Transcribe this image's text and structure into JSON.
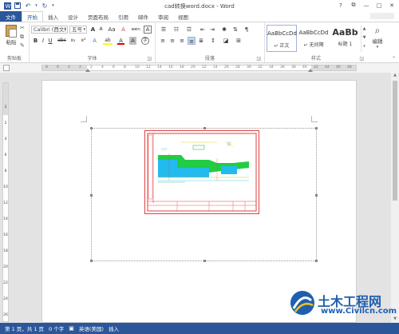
{
  "window": {
    "title": "cad转换word.docx - Word",
    "controls": {
      "help": "?",
      "restore": "⧉",
      "minimize": "—",
      "maximize": "□",
      "close": "✕"
    }
  },
  "quick_access": {
    "save": "save-icon",
    "undo": "undo-icon",
    "redo": "redo-icon"
  },
  "tabs": [
    {
      "label": "文件"
    },
    {
      "label": "开始"
    },
    {
      "label": "插入"
    },
    {
      "label": "设计"
    },
    {
      "label": "页面布局"
    },
    {
      "label": "引用"
    },
    {
      "label": "邮件"
    },
    {
      "label": "审阅"
    },
    {
      "label": "视图"
    }
  ],
  "ribbon": {
    "clipboard": {
      "paste_label": "粘贴",
      "group_label": "剪贴板"
    },
    "font": {
      "font_name": "Calibri (西文)",
      "font_size": "五号",
      "grow": "A",
      "shrink": "A",
      "case": "Aa",
      "clear": "A",
      "wen": "wén",
      "char_border": "A",
      "bold": "B",
      "italic": "I",
      "underline": "U",
      "strike": "abc",
      "subscript": "x₂",
      "superscript": "x²",
      "text_effects": "A",
      "highlight": "ab",
      "font_color": "A",
      "char_shading": "A",
      "enclose": "字",
      "group_label": "字体"
    },
    "paragraph": {
      "group_label": "段落"
    },
    "styles": {
      "items": [
        {
          "sample": "AaBbCcDd",
          "name": "↵ 正文"
        },
        {
          "sample": "AaBbCcDd",
          "name": "↵ 无间隔"
        },
        {
          "sample": "AaBb",
          "name": "标题 1"
        }
      ],
      "group_label": "样式"
    },
    "editing": {
      "label": "编辑"
    }
  },
  "ruler": {
    "h_ticks": [
      "8",
      "6",
      "4",
      "2",
      "2",
      "4",
      "6",
      "8",
      "10",
      "12",
      "14",
      "16",
      "18",
      "20",
      "22",
      "24",
      "26",
      "28",
      "30",
      "32",
      "34",
      "36",
      "38",
      "40",
      "42",
      "44",
      "46",
      "48"
    ],
    "v_ticks": [
      "2",
      "2",
      "4",
      "6",
      "8",
      "10",
      "12",
      "14",
      "16",
      "18",
      "20",
      "22",
      "24",
      "26"
    ]
  },
  "statusbar": {
    "page": "第 1 页，共 1 页",
    "words": "0 个字",
    "language": "英语(美国)",
    "mode": "插入"
  },
  "watermark": {
    "text": "土木工程网",
    "url": "www.Civilcn.com"
  },
  "colors": {
    "accent": "#2b579a",
    "drawing_border": "#e04040",
    "drawing_green": "#22cc44",
    "drawing_cyan": "#22bbee"
  }
}
